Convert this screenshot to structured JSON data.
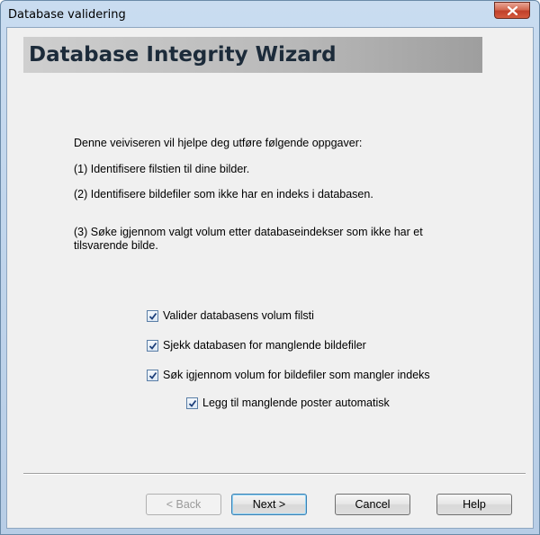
{
  "window": {
    "title": "Database validering"
  },
  "banner": {
    "title": "Database Integrity Wizard"
  },
  "description": {
    "intro": "Denne veiviseren vil hjelpe deg utføre følgende oppgaver:",
    "step1": "(1) Identifisere filstien til dine bilder.",
    "step2": "(2) Identifisere bildefiler som ikke har en indeks i databasen.",
    "step3": "(3) Søke igjennom valgt volum etter databaseindekser som ikke har et tilsvarende bilde."
  },
  "options": [
    {
      "label": "Valider databasens volum filsti",
      "checked": true
    },
    {
      "label": "Sjekk databasen for manglende bildefiler",
      "checked": true
    },
    {
      "label": "Søk igjennom volum for bildefiler som mangler indeks",
      "checked": true
    },
    {
      "label": "Legg til manglende poster automatisk",
      "checked": true
    }
  ],
  "buttons": {
    "back": "< Back",
    "next": "Next >",
    "cancel": "Cancel",
    "help": "Help"
  }
}
